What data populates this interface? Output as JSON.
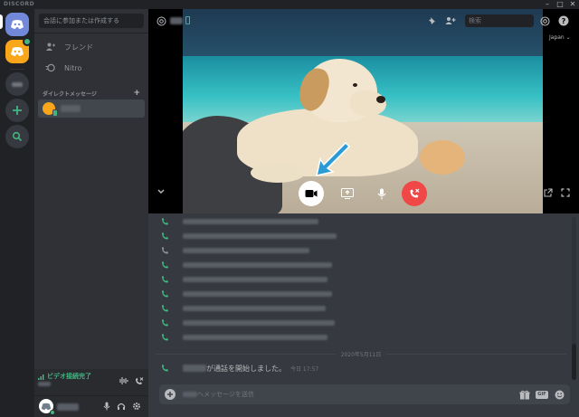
{
  "app": {
    "brand": "DISCORD"
  },
  "sidebar": {
    "search_placeholder": "会話に参加または作成する",
    "nav": [
      {
        "label": "フレンド"
      },
      {
        "label": "Nitro"
      }
    ],
    "dm_header": "ダイレクトメッセージ",
    "dm_add": "+"
  },
  "voice": {
    "status": "ビデオ接続完了"
  },
  "call": {
    "search_placeholder": "検索",
    "region": "Japan"
  },
  "messages": {
    "date_divider": "2020年5月11日",
    "system_message": "が通話を開始しました。",
    "system_time": "今日 17:57"
  },
  "composer": {
    "placeholder": "へメッセージを送信",
    "gif_label": "GIF"
  },
  "colors": {
    "blurple": "#7289da",
    "green": "#43b581",
    "red": "#f04747",
    "accent_arrow": "#2b9bd6"
  }
}
